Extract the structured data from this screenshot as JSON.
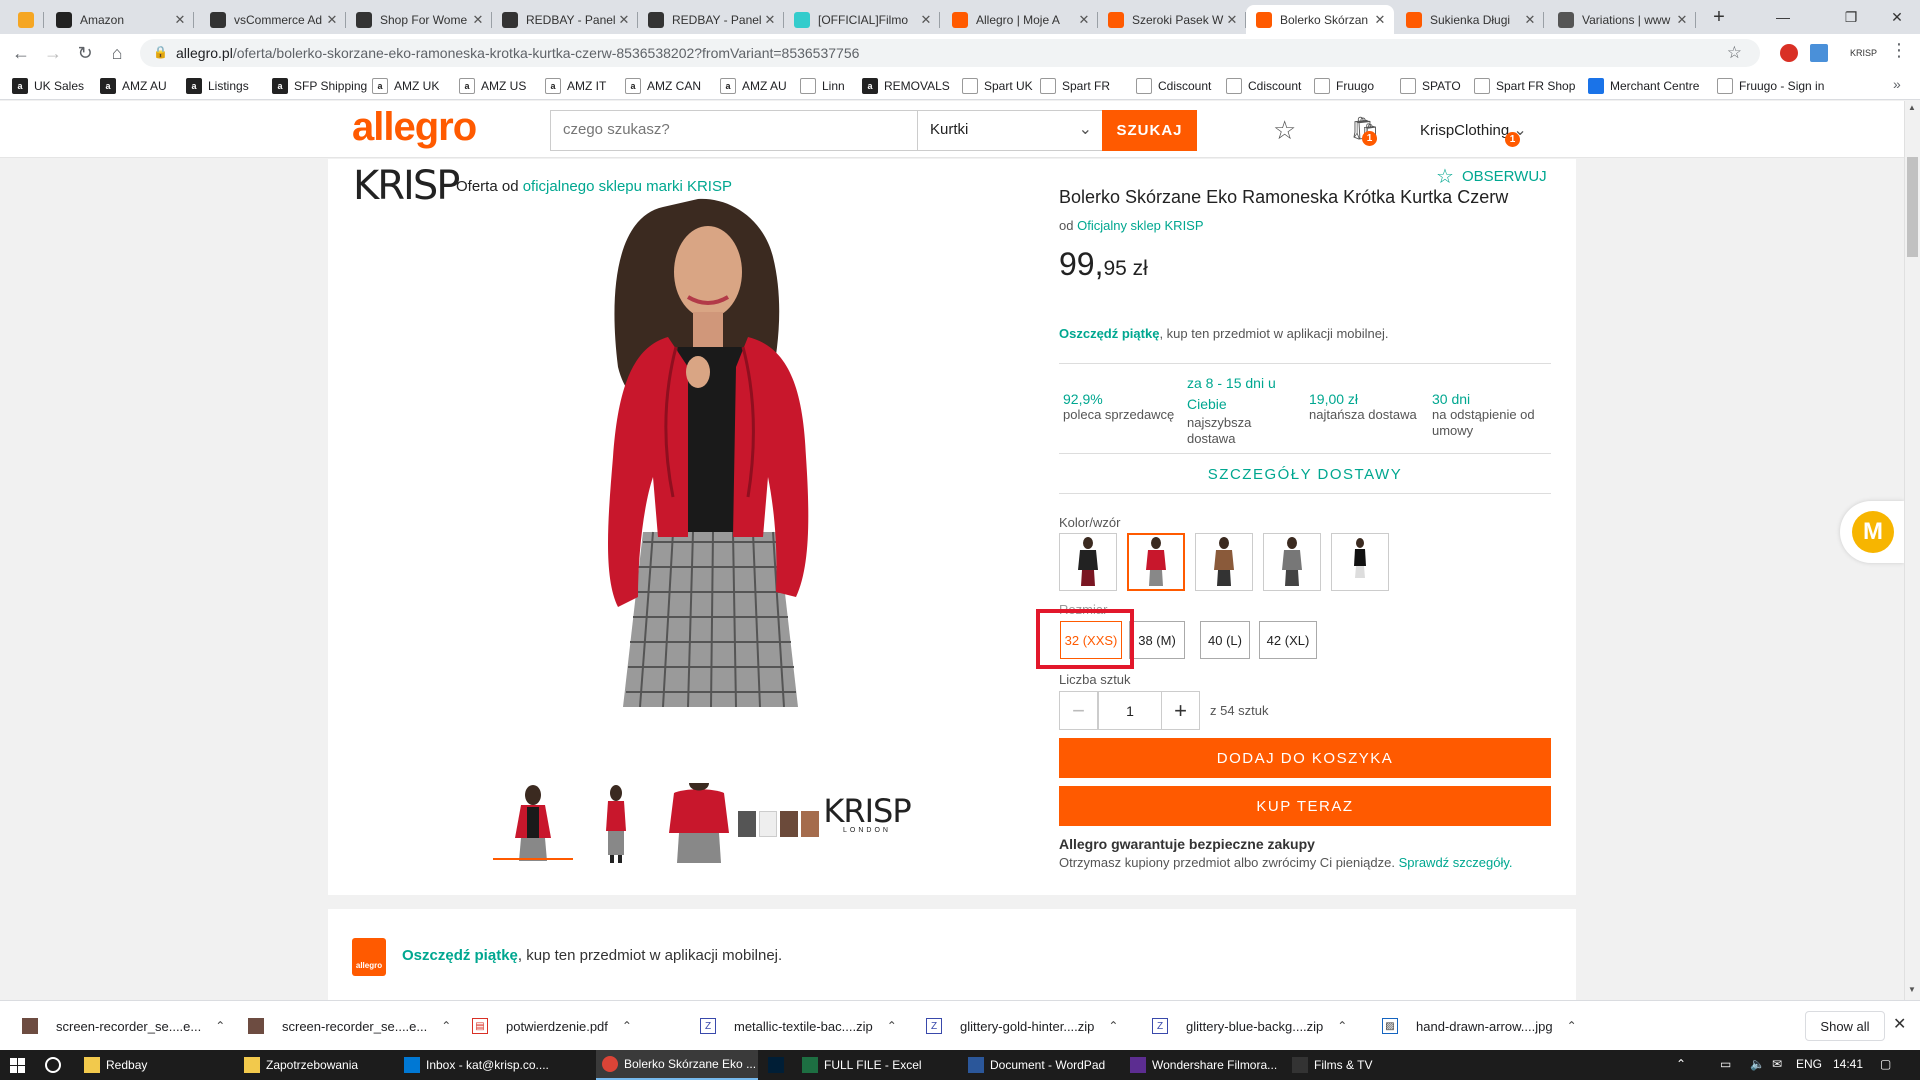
{
  "browser": {
    "tabs": [
      {
        "title": "",
        "favicon": "color-bars-icon",
        "color": "#f5a623"
      },
      {
        "title": "Amazon",
        "favicon": "amazon-icon",
        "color": "#222222"
      },
      {
        "title": "vsCommerce Ad",
        "favicon": "k-icon",
        "color": "#ffffff"
      },
      {
        "title": "Shop For Wome",
        "favicon": "k-icon",
        "color": "#ffffff"
      },
      {
        "title": "REDBAY - Panel",
        "favicon": "redbay-icon",
        "color": "#ffffff"
      },
      {
        "title": "REDBAY - Panel",
        "favicon": "redbay-icon",
        "color": "#ffffff"
      },
      {
        "title": "[OFFICIAL]Filmo",
        "favicon": "filmora-icon",
        "color": "#3cc"
      },
      {
        "title": "Allegro | Moje A",
        "favicon": "allegro-icon",
        "color": "#ff5a00"
      },
      {
        "title": "Szeroki Pasek W",
        "favicon": "allegro-icon",
        "color": "#ff5a00"
      },
      {
        "title": "Bolerko Skórzan",
        "favicon": "allegro-icon",
        "color": "#ff5a00"
      },
      {
        "title": "Sukienka Długi",
        "favicon": "allegro-icon",
        "color": "#ff5a00"
      },
      {
        "title": "Variations | www",
        "favicon": "globe-icon",
        "color": "#555555"
      }
    ],
    "url_host": "allegro.pl",
    "url_path": "/oferta/bolerko-skorzane-eko-ramoneska-krotka-kurtka-czerw-8536538202?fromVariant=8536537756",
    "bookmarks": [
      {
        "label": "UK Sales",
        "icon": "amazon-icon"
      },
      {
        "label": "AMZ AU",
        "icon": "amazon-icon"
      },
      {
        "label": "Listings",
        "icon": "amazon-icon"
      },
      {
        "label": "SFP Shipping",
        "icon": "amazon-icon"
      },
      {
        "label": "AMZ UK",
        "icon": "amazon-smile-icon"
      },
      {
        "label": "AMZ US",
        "icon": "amazon-smile-icon"
      },
      {
        "label": "AMZ IT",
        "icon": "amazon-smile-icon"
      },
      {
        "label": "AMZ CAN",
        "icon": "amazon-smile-icon"
      },
      {
        "label": "AMZ AU",
        "icon": "amazon-smile-icon"
      },
      {
        "label": "Linn",
        "icon": "globe-icon"
      },
      {
        "label": "REMOVALS",
        "icon": "amazon-icon"
      },
      {
        "label": "Spart UK",
        "icon": "spart-icon"
      },
      {
        "label": "Spart FR",
        "icon": "spart-icon"
      },
      {
        "label": "Cdiscount",
        "icon": "cdiscount-icon"
      },
      {
        "label": "Cdiscount",
        "icon": "cdiscount-icon"
      },
      {
        "label": "Fruugo",
        "icon": "fruugo-icon"
      },
      {
        "label": "SPATO",
        "icon": "spart-icon"
      },
      {
        "label": "Spart FR Shop",
        "icon": "spart-icon"
      },
      {
        "label": "Merchant Centre",
        "icon": "windows-icon"
      },
      {
        "label": "Fruugo - Sign in",
        "icon": "fruugo-icon"
      }
    ]
  },
  "header": {
    "logo": "allegro",
    "search_placeholder": "czego szukasz?",
    "category": "Kurtki",
    "search_button": "SZUKAJ",
    "cart_count": "1",
    "user_name": "KrispClothing",
    "user_badge": "1"
  },
  "product": {
    "brand_logo": "KRISP",
    "offer_prefix": "Oferta od",
    "offer_link": "oficjalnego sklepu marki KRISP",
    "observe": "OBSERWUJ",
    "title": "Bolerko Skórzane Eko Ramoneska Krótka Kurtka Czerw",
    "seller_prefix": "od",
    "seller_link": "Oficjalny sklep KRISP",
    "price_main": "99,",
    "price_fraction": "95 zł",
    "save_bold": "Oszczędź piątkę",
    "save_rest": ", kup ten przedmiot w aplikacji mobilnej.",
    "stats": [
      {
        "value": "92,9%",
        "label": "poleca sprzedawcę"
      },
      {
        "value": "za 8 - 15 dni u Ciebie",
        "label": "najszybsza dostawa"
      },
      {
        "value": "19,00 zł",
        "label": "najtańsza dostawa"
      },
      {
        "value": "30 dni",
        "label": "na odstąpienie od umowy"
      }
    ],
    "delivery_details": "SZCZEGÓŁY DOSTAWY",
    "color_label": "Kolor/wzór",
    "size_label": "Rozmiar",
    "sizes": [
      "32 (XXS)",
      "38 (M)",
      "40 (L)",
      "42 (XL)"
    ],
    "selected_size": "32 (XXS)",
    "qty_label": "Liczba sztuk",
    "qty_value": "1",
    "qty_available": "z 54 sztuk",
    "add_to_cart": "DODAJ DO KOSZYKA",
    "buy_now": "KUP TERAZ",
    "guarantee_title": "Allegro gwarantuje bezpieczne zakupy",
    "guarantee_text": "Otrzymasz kupiony przedmiot albo zwrócimy Ci pieniądze.",
    "guarantee_link": "Sprawdź szczegóły.",
    "thumb_brand": "KRISP",
    "thumb_brand_sub": "LONDON"
  },
  "promo": {
    "icon_text": "allegro",
    "bold": "Oszczędź piątkę",
    "rest": ", kup ten przedmiot w aplikacji mobilnej."
  },
  "downloads": [
    {
      "name": "screen-recorder_se....e...",
      "icon": "file-icon"
    },
    {
      "name": "screen-recorder_se....e...",
      "icon": "file-icon"
    },
    {
      "name": "potwierdzenie.pdf",
      "icon": "pdf-icon"
    },
    {
      "name": "metallic-textile-bac....zip",
      "icon": "zip-icon"
    },
    {
      "name": "glittery-gold-hinter....zip",
      "icon": "zip-icon"
    },
    {
      "name": "glittery-blue-backg....zip",
      "icon": "zip-icon"
    },
    {
      "name": "hand-drawn-arrow....jpg",
      "icon": "image-icon"
    }
  ],
  "show_all": "Show all",
  "taskbar": {
    "items": [
      {
        "label": "Redbay",
        "icon": "folder-icon",
        "color": "#f2c94c"
      },
      {
        "label": "Zapotrzebowania",
        "icon": "folder-icon",
        "color": "#f2c94c"
      },
      {
        "label": "Inbox - kat@krisp.co....",
        "icon": "outlook-icon",
        "color": "#0078d4"
      },
      {
        "label": "Bolerko Skórzane Eko ...",
        "icon": "chrome-icon",
        "color": "#db4437"
      },
      {
        "label": "",
        "icon": "photoshop-icon",
        "color": "#001e36"
      },
      {
        "label": "FULL FILE - Excel",
        "icon": "excel-icon",
        "color": "#1d6f42"
      },
      {
        "label": "Document - WordPad",
        "icon": "wordpad-icon",
        "color": "#2b579a"
      },
      {
        "label": "Wondershare Filmora...",
        "icon": "filmora-icon",
        "color": "#5c2d91"
      },
      {
        "label": "Films & TV",
        "icon": "films-icon",
        "color": "#333333"
      }
    ],
    "lang": "ENG",
    "time": "14:41"
  }
}
